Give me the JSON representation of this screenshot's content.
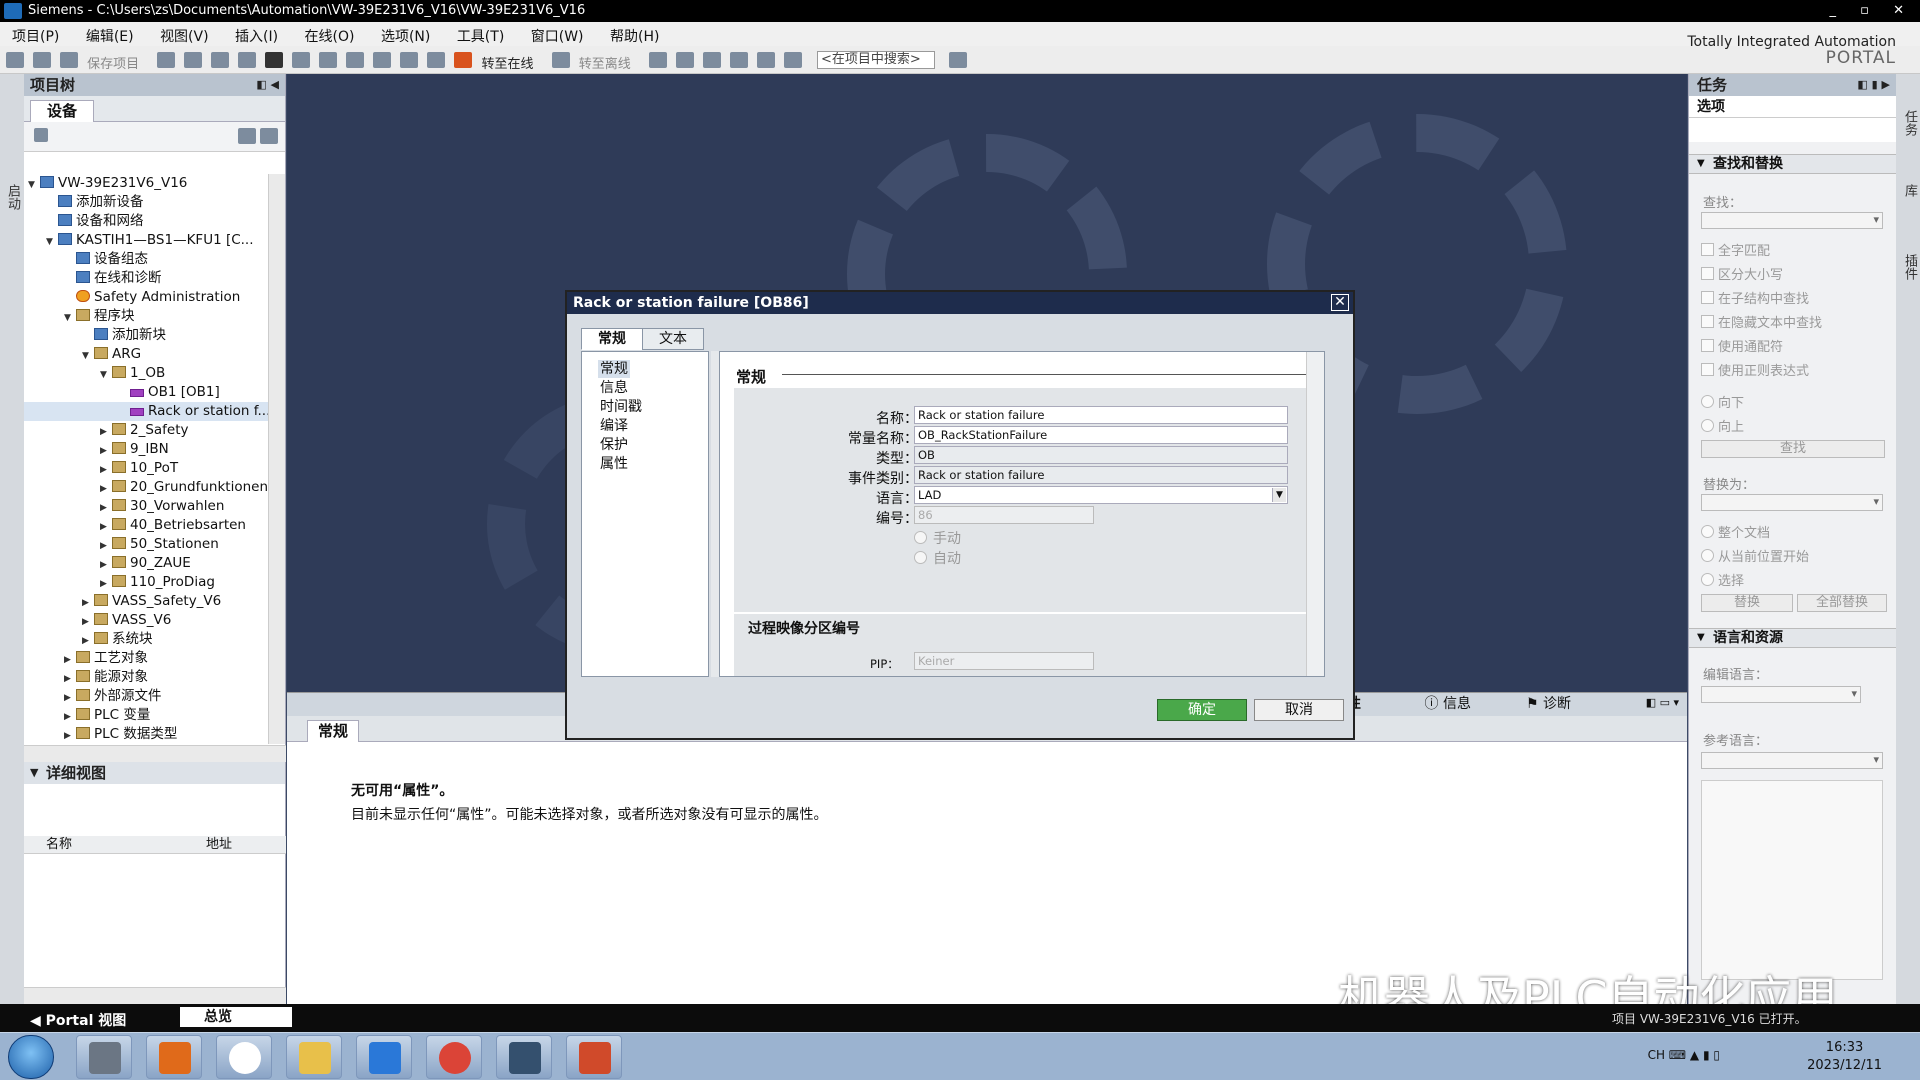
{
  "window": {
    "title": "Siemens  -  C:\\Users\\zs\\Documents\\Automation\\VW-39E231V6_V16\\VW-39E231V6_V16",
    "controls": "_ ▫ ✕"
  },
  "menu": [
    "项目(P)",
    "编辑(E)",
    "视图(V)",
    "插入(I)",
    "在线(O)",
    "选项(N)",
    "工具(T)",
    "窗口(W)",
    "帮助(H)"
  ],
  "toolbar": {
    "save_project": "保存项目",
    "go_online": "转至在线",
    "go_offline": "转至离线",
    "search_placeholder": "<在项目中搜索>"
  },
  "branding": {
    "line1": "Totally Integrated Automation",
    "line2": "PORTAL"
  },
  "left_strip_label": "启动",
  "project_tree": {
    "header": "项目树",
    "tab": "设备",
    "items": [
      {
        "label": "VW-39E231V6_V16",
        "level": 0,
        "arrow": "▼",
        "icon": "project-icon"
      },
      {
        "label": "添加新设备",
        "level": 1,
        "arrow": "",
        "icon": "add-device-icon"
      },
      {
        "label": "设备和网络",
        "level": 1,
        "arrow": "",
        "icon": "network-icon"
      },
      {
        "label": "KASTIH1—BS1—KFU1 [C...",
        "level": 1,
        "arrow": "▼",
        "icon": "plc-icon"
      },
      {
        "label": "设备组态",
        "level": 2,
        "arrow": "",
        "icon": "device-config-icon"
      },
      {
        "label": "在线和诊断",
        "level": 2,
        "arrow": "",
        "icon": "diagnostics-icon"
      },
      {
        "label": "Safety Administration",
        "level": 2,
        "arrow": "",
        "icon": "safety-icon"
      },
      {
        "label": "程序块",
        "level": 2,
        "arrow": "▼",
        "icon": "folder-icon"
      },
      {
        "label": "添加新块",
        "level": 3,
        "arrow": "",
        "icon": "add-block-icon"
      },
      {
        "label": "ARG",
        "level": 3,
        "arrow": "▼",
        "icon": "folder-icon"
      },
      {
        "label": "1_OB",
        "level": 4,
        "arrow": "▼",
        "icon": "folder-icon"
      },
      {
        "label": "OB1 [OB1]",
        "level": 5,
        "arrow": "",
        "icon": "ob-icon"
      },
      {
        "label": "Rack or station f...",
        "level": 5,
        "arrow": "",
        "icon": "ob-icon",
        "selected": true
      },
      {
        "label": "2_Safety",
        "level": 4,
        "arrow": "▶",
        "icon": "folder-icon"
      },
      {
        "label": "9_IBN",
        "level": 4,
        "arrow": "▶",
        "icon": "folder-icon"
      },
      {
        "label": "10_PoT",
        "level": 4,
        "arrow": "▶",
        "icon": "folder-icon"
      },
      {
        "label": "20_Grundfunktionen",
        "level": 4,
        "arrow": "▶",
        "icon": "folder-icon"
      },
      {
        "label": "30_Vorwahlen",
        "level": 4,
        "arrow": "▶",
        "icon": "folder-icon"
      },
      {
        "label": "40_Betriebsarten",
        "level": 4,
        "arrow": "▶",
        "icon": "folder-icon"
      },
      {
        "label": "50_Stationen",
        "level": 4,
        "arrow": "▶",
        "icon": "folder-icon"
      },
      {
        "label": "90_ZAUE",
        "level": 4,
        "arrow": "▶",
        "icon": "folder-icon"
      },
      {
        "label": "110_ProDiag",
        "level": 4,
        "arrow": "▶",
        "icon": "folder-icon"
      },
      {
        "label": "VASS_Safety_V6",
        "level": 3,
        "arrow": "▶",
        "icon": "folder-icon"
      },
      {
        "label": "VASS_V6",
        "level": 3,
        "arrow": "▶",
        "icon": "folder-icon"
      },
      {
        "label": "系统块",
        "level": 3,
        "arrow": "▶",
        "icon": "folder-icon"
      },
      {
        "label": "工艺对象",
        "level": 2,
        "arrow": "▶",
        "icon": "folder-icon"
      },
      {
        "label": "能源对象",
        "level": 2,
        "arrow": "▶",
        "icon": "folder-icon"
      },
      {
        "label": "外部源文件",
        "level": 2,
        "arrow": "▶",
        "icon": "folder-icon"
      },
      {
        "label": "PLC 变量",
        "level": 2,
        "arrow": "▶",
        "icon": "folder-icon"
      },
      {
        "label": "PLC 数据类型",
        "level": 2,
        "arrow": "▶",
        "icon": "folder-icon"
      }
    ]
  },
  "detail_view": {
    "header": "详细视图",
    "col_name": "名称",
    "col_address": "地址"
  },
  "properties": {
    "tab_general": "常规",
    "msg_title": "无可用“属性”。",
    "msg_body": "目前未显示任何“属性”。可能未选择对象，或者所选对象没有可显示的属性。",
    "tab_props": "属性",
    "tab_info": "信息",
    "tab_diag": "诊断"
  },
  "dialog": {
    "title": "Rack or station failure [OB86]",
    "tabs": [
      "常规",
      "文本"
    ],
    "nav": [
      "常规",
      "信息",
      "时间戳",
      "编译",
      "保护",
      "属性"
    ],
    "section": "常规",
    "fields": {
      "name_label": "名称：",
      "name_value": "Rack or station failure",
      "const_label": "常量名称：",
      "const_value": "OB_RackStationFailure",
      "type_label": "类型：",
      "type_value": "OB",
      "event_label": "事件类别：",
      "event_value": "Rack or station failure",
      "lang_label": "语言：",
      "lang_value": "LAD",
      "num_label": "编号：",
      "num_value": "86",
      "manual": "手动",
      "auto": "自动"
    },
    "pip_section": "过程映像分区编号",
    "pip_label": "PIP：",
    "pip_value": "Keiner",
    "ok": "确定",
    "cancel": "取消"
  },
  "task_panel": {
    "header": "任务",
    "options": "选项",
    "find_replace": "查找和替换",
    "find_label": "查找：",
    "checks": [
      "全字匹配",
      "区分大小写",
      "在子结构中查找",
      "在隐藏文本中查找",
      "使用通配符",
      "使用正则表达式"
    ],
    "dir_down": "向下",
    "dir_up": "向上",
    "find_btn": "查找",
    "replace_label": "替换为：",
    "scope": [
      "整个文档",
      "从当前位置开始",
      "选择"
    ],
    "replace_btn": "替换",
    "replace_all_btn": "全部替换",
    "lang_section": "语言和资源",
    "edit_lang": "编辑语言：",
    "ref_lang": "参考语言："
  },
  "right_strip": [
    "任务",
    "库",
    "插件"
  ],
  "bottom": {
    "portal_view": "Portal 视图",
    "overview": "总览",
    "status": "项目 VW-39E231V6_V16 已打开。"
  },
  "watermark": "机器人及PLC自动化应用",
  "taskbar": {
    "lang": "CH",
    "time": "16:33",
    "date": "2023/12/11"
  }
}
